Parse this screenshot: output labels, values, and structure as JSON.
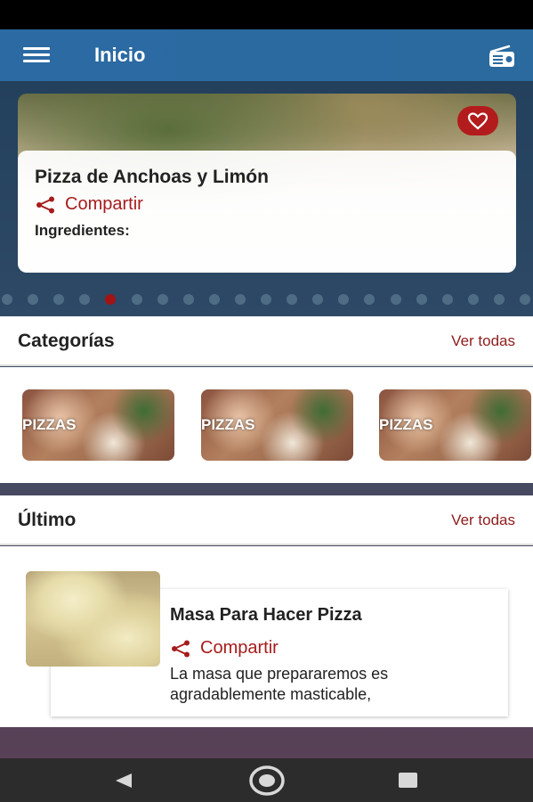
{
  "app_bar": {
    "title": "Inicio",
    "menu_icon": "hamburger-menu-icon",
    "radio_icon": "radio-icon",
    "background": "#2b6aa3"
  },
  "hero": {
    "title": "Pizza de Anchoas y Limón",
    "share_label": "Compartir",
    "ingredients_label": "Ingredientes:",
    "favorite_icon": "heart-icon",
    "accent": "#a61c1c",
    "carousel": {
      "total": 21,
      "active_index": 4
    }
  },
  "categories": {
    "title": "Categorías",
    "see_all": "Ver todas",
    "items": [
      {
        "label": "PIZZAS"
      },
      {
        "label": "PIZZAS"
      },
      {
        "label": "PIZZAS"
      }
    ]
  },
  "latest": {
    "title": "Último",
    "see_all": "Ver todas",
    "items": [
      {
        "title": "Masa Para Hacer Pizza",
        "share_label": "Compartir",
        "description": "La masa que prepararemos es agradablemente masticable,"
      }
    ]
  },
  "system_nav": {
    "back_icon": "back-triangle-icon",
    "home_icon": "home-circle-icon",
    "recents_icon": "recents-square-icon"
  }
}
